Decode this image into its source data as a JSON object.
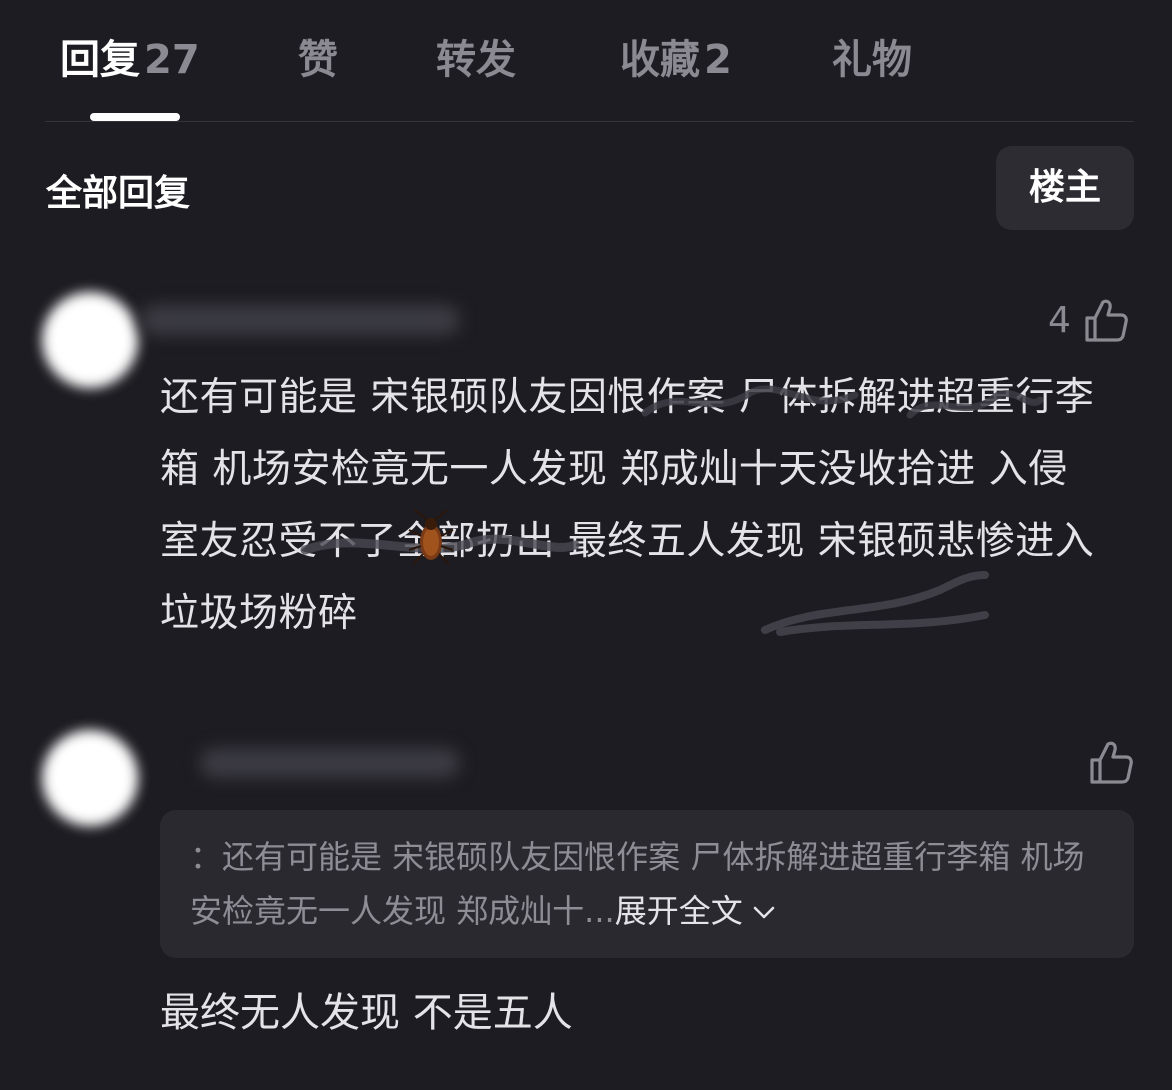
{
  "tabs": [
    {
      "label": "回复",
      "count": "27"
    },
    {
      "label": "赞"
    },
    {
      "label": "转发"
    },
    {
      "label": "收藏",
      "count": "2"
    },
    {
      "label": "礼物"
    }
  ],
  "section": {
    "title": "全部回复",
    "op_button": "楼主"
  },
  "comments": [
    {
      "likes": "4",
      "text": "还有可能是 宋银硕队友因恨作案 尸体拆解进超重行李箱 机场安检竟无一人发现 郑成灿十天没收拾进 入侵 室友忍受不了全部扔出 最终五人发现 宋银硕悲惨进入垃圾场粉碎"
    },
    {
      "likes": "",
      "quote": "：还有可能是 宋银硕队友因恨作案 尸体拆解进超重行李箱 机场安检竟无一人发现 郑成灿十...",
      "expand": "展开全文",
      "text": "最终无人发现 不是五人"
    }
  ],
  "icons": {
    "like": "thumbs-up-icon",
    "chevron": "chevron-down-icon",
    "bug": "cockroach-icon"
  }
}
